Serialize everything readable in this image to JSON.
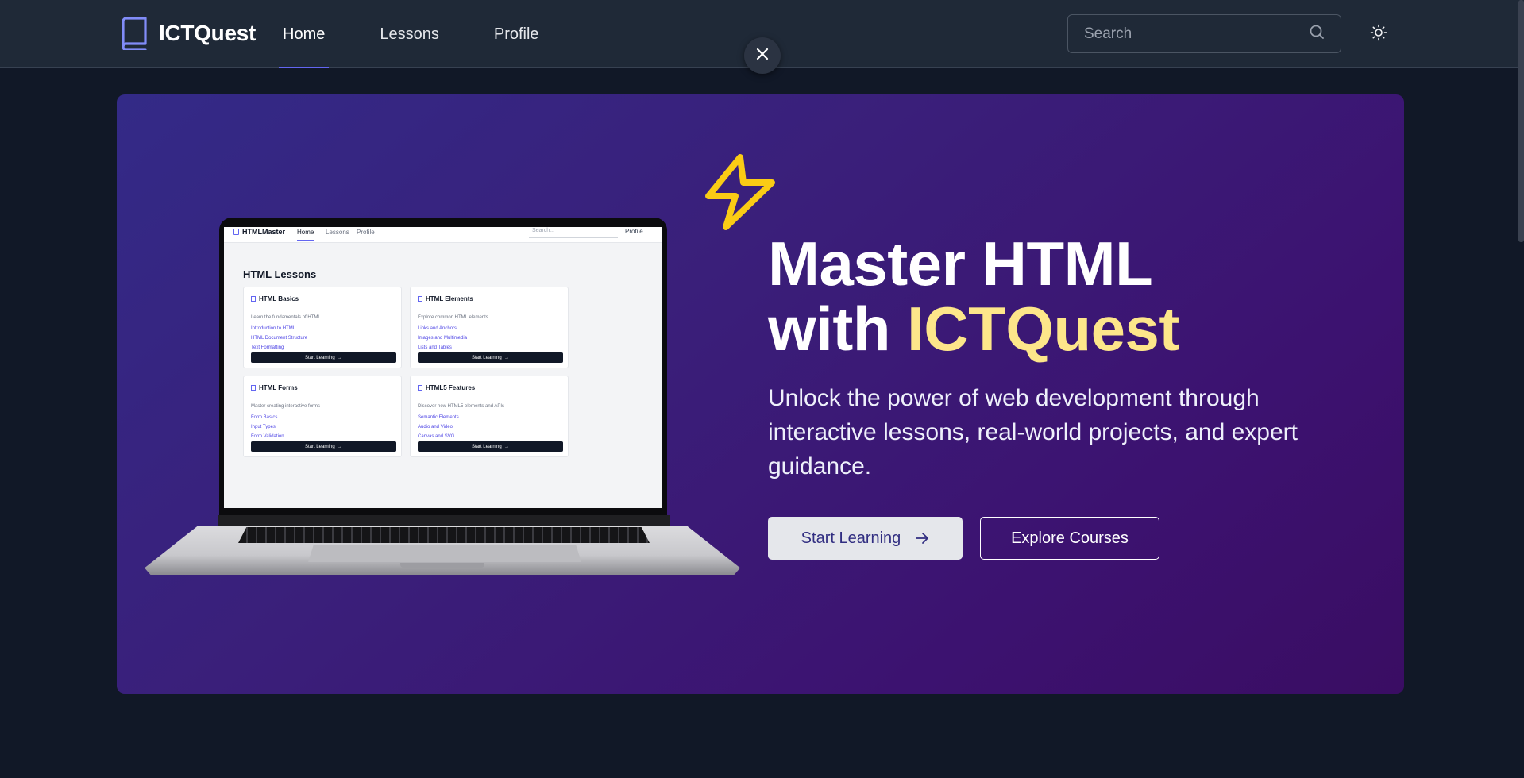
{
  "app": {
    "name": "ICTQuest"
  },
  "nav": {
    "items": [
      {
        "label": "Home",
        "active": true
      },
      {
        "label": "Lessons",
        "active": false
      },
      {
        "label": "Profile",
        "active": false
      }
    ]
  },
  "search": {
    "placeholder": "Search"
  },
  "hero": {
    "title_line1": "Master HTML",
    "title_line2_prefix": "with ",
    "title_line2_highlight": "ICTQuest",
    "subtitle": "Unlock the power of web development through interactive lessons, real-world projects, and expert guidance.",
    "primary_button": "Start Learning",
    "secondary_button": "Explore Courses"
  },
  "laptop_screen": {
    "brand": "HTMLMaster",
    "nav": [
      "Home",
      "Lessons",
      "Profile"
    ],
    "search_placeholder": "Search...",
    "profile": "Profile",
    "heading": "HTML Lessons",
    "cards": [
      {
        "title": "HTML Basics",
        "desc": "Learn the fundamentals of HTML",
        "links": [
          "Introduction to HTML",
          "HTML Document Structure",
          "Text Formatting"
        ],
        "button": "Start Learning"
      },
      {
        "title": "HTML Elements",
        "desc": "Explore common HTML elements",
        "links": [
          "Links and Anchors",
          "Images and Multimedia",
          "Lists and Tables"
        ],
        "button": "Start Learning"
      },
      {
        "title": "HTML Forms",
        "desc": "Master creating interactive forms",
        "links": [
          "Form Basics",
          "Input Types",
          "Form Validation"
        ],
        "button": "Start Learning"
      },
      {
        "title": "HTML5 Features",
        "desc": "Discover new HTML5 elements and APIs",
        "links": [
          "Semantic Elements",
          "Audio and Video",
          "Canvas and SVG"
        ],
        "button": "Start Learning"
      }
    ]
  },
  "icons": {
    "brand": "book-icon",
    "search": "search-icon",
    "theme": "sun-icon",
    "close": "close-icon",
    "bolt": "lightning-bolt-icon",
    "arrow": "arrow-right-icon"
  },
  "colors": {
    "background": "#111827",
    "navbar": "#1f2937",
    "accent": "#6366f1",
    "highlight": "#fde68a",
    "bolt": "#facc15",
    "hero_start": "#332a87",
    "hero_end": "#3a0d63",
    "primary_button_bg": "#e5e7eb",
    "primary_button_text": "#312e81"
  }
}
